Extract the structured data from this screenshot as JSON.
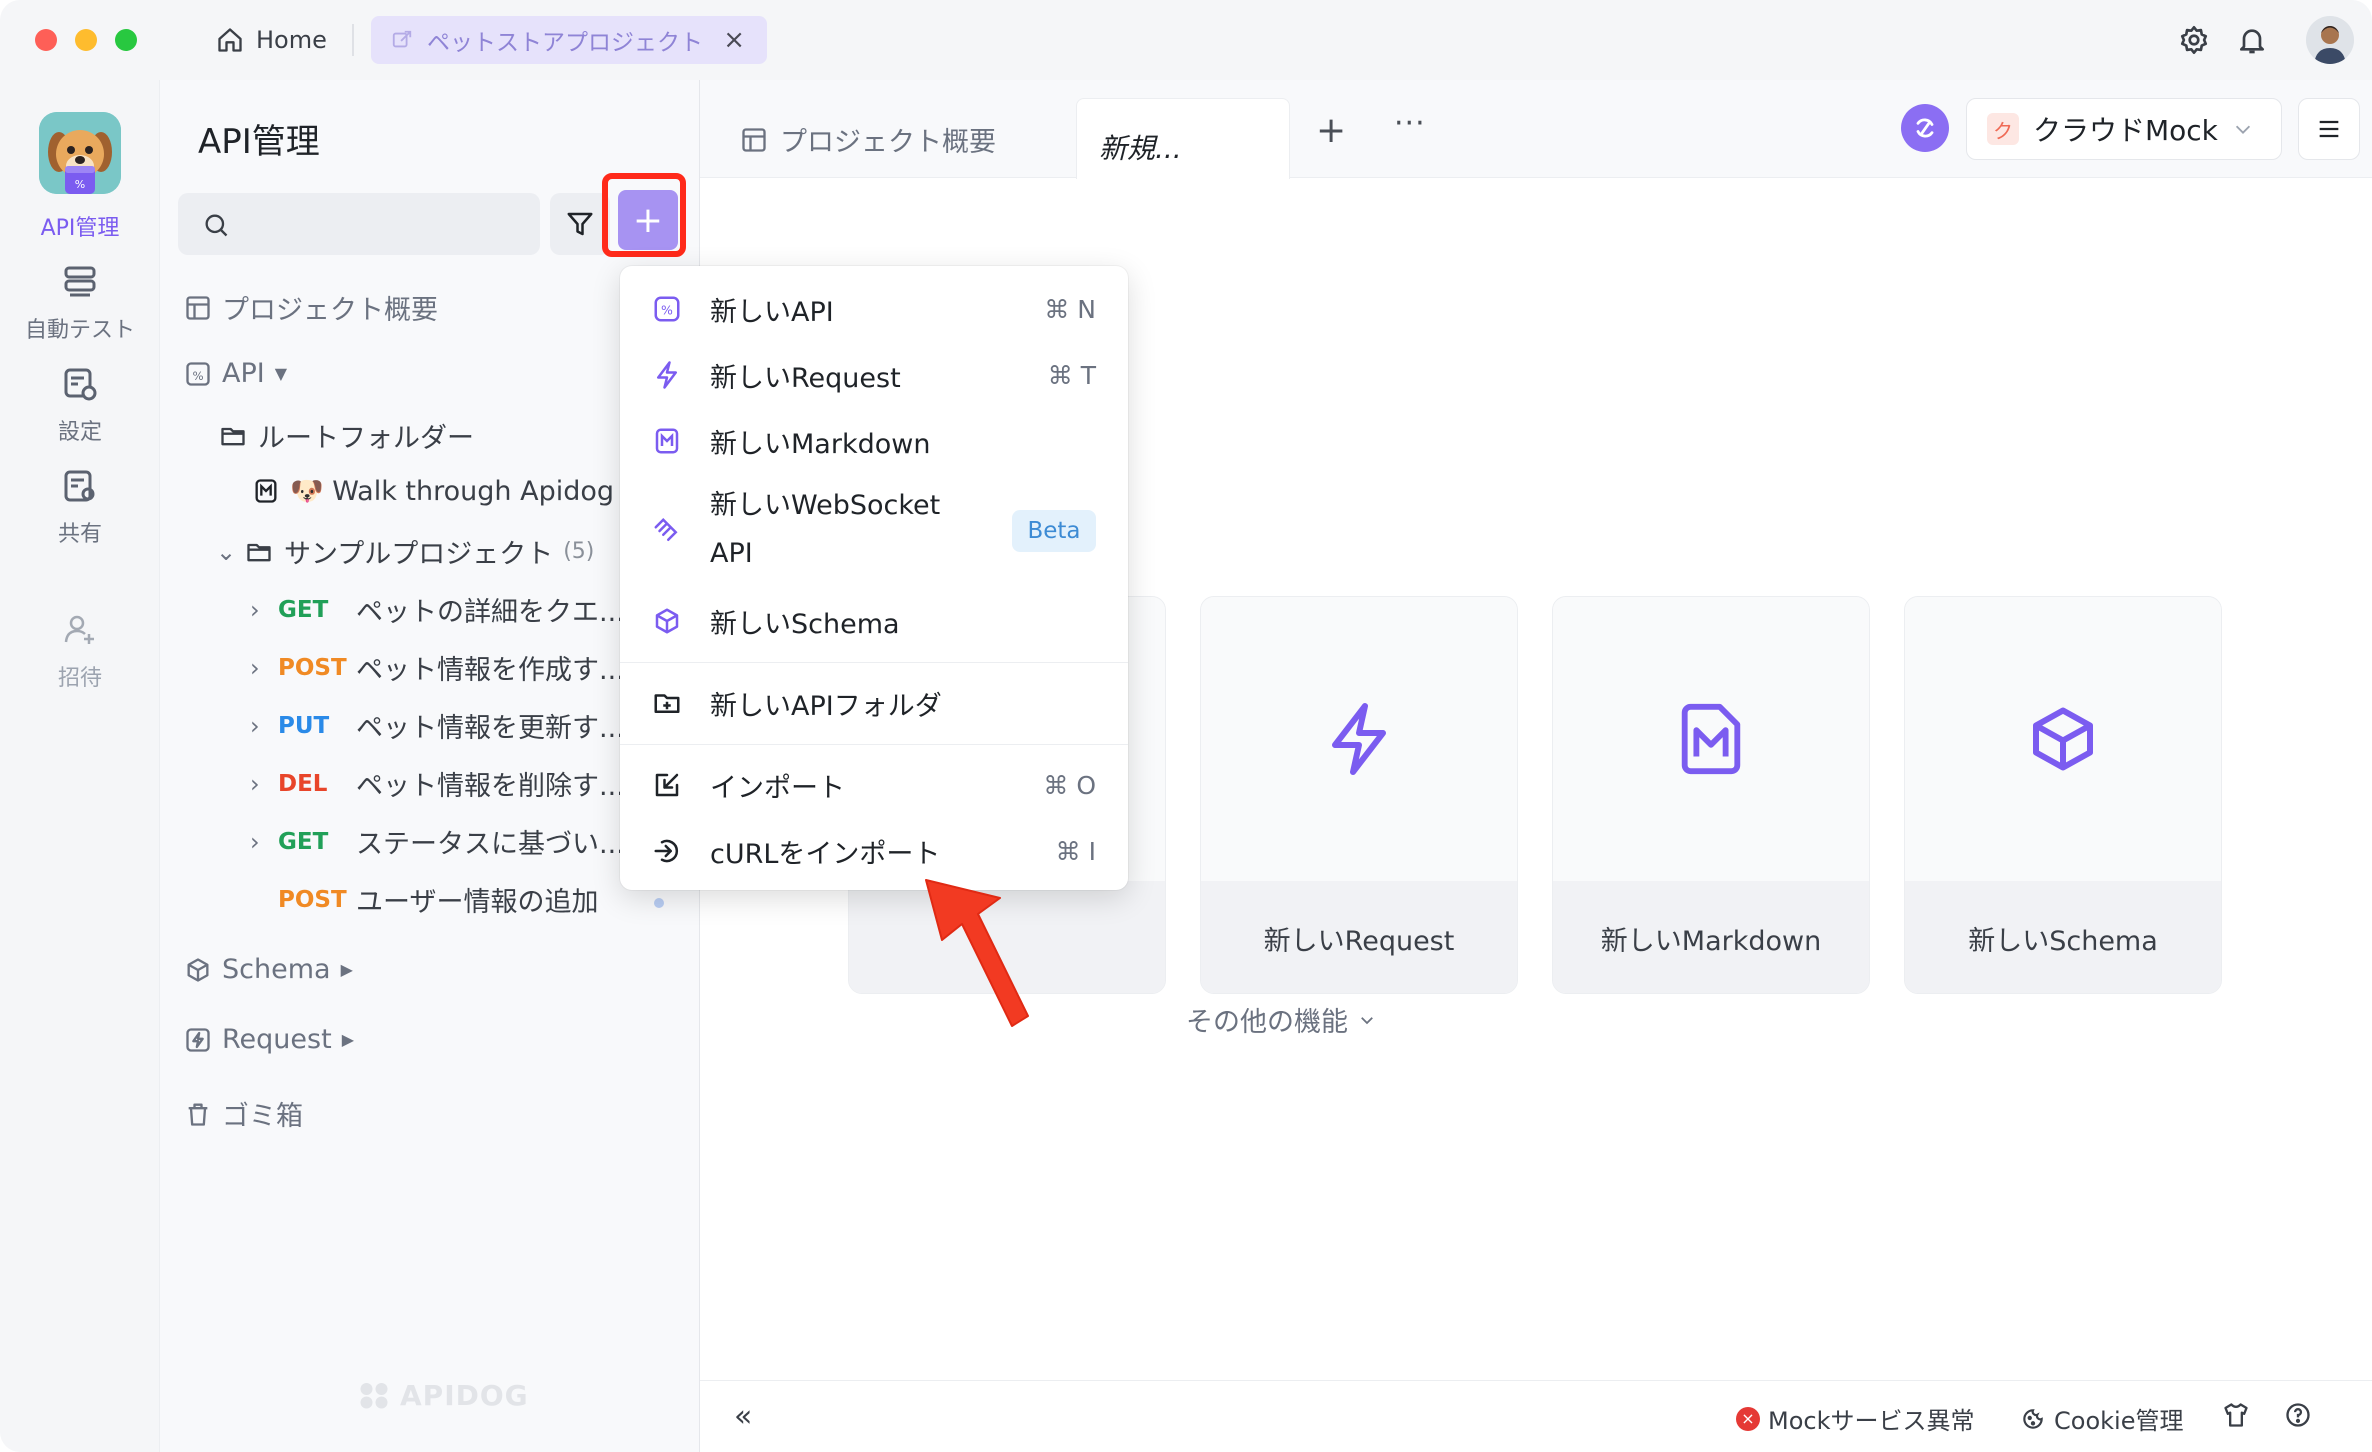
{
  "titlebar": {
    "home_label": "Home",
    "project_tab_label": "ペットストアプロジェクト"
  },
  "rail": {
    "items": [
      {
        "label": "API管理"
      },
      {
        "label": "自動テスト"
      },
      {
        "label": "設定"
      },
      {
        "label": "共有"
      },
      {
        "label": "招待"
      }
    ]
  },
  "sidebar": {
    "title": "API管理",
    "tree": {
      "overview": "プロジェクト概要",
      "api": "API",
      "root_folder": "ルートフォルダー",
      "walkthrough": "🐶 Walk through Apidog",
      "sample_project": "サンプルプロジェクト",
      "sample_count": "(5)",
      "endpoints": [
        {
          "method": "GET",
          "name": "ペットの詳細をクエ..."
        },
        {
          "method": "POST",
          "name": "ペット情報を作成す..."
        },
        {
          "method": "PUT",
          "name": "ペット情報を更新す..."
        },
        {
          "method": "DEL",
          "name": "ペット情報を削除す..."
        },
        {
          "method": "GET",
          "name": "ステータスに基づい..."
        }
      ],
      "user_add": {
        "method": "POST",
        "name": "ユーザー情報の追加"
      },
      "schema": "Schema",
      "request": "Request",
      "trash": "ゴミ箱"
    },
    "watermark": "APIDOG"
  },
  "main": {
    "tabs": {
      "overview": "プロジェクト概要",
      "new": "新規..."
    },
    "env_label": "クラウドMock",
    "env_badge": "ク",
    "cards": [
      {
        "label": "新しいRequest",
        "icon": "lightning-icon"
      },
      {
        "label": "新しいMarkdown",
        "icon": "markdown-icon"
      },
      {
        "label": "新しいSchema",
        "icon": "cube-icon"
      }
    ],
    "more_funcs": "その他の機能"
  },
  "statusbar": {
    "mock_error": "Mockサービス異常",
    "cookie": "Cookie管理"
  },
  "dropdown": {
    "items": [
      {
        "label": "新しいAPI",
        "shortcut": "⌘ N"
      },
      {
        "label": "新しいRequest",
        "shortcut": "⌘ T"
      },
      {
        "label": "新しいMarkdown",
        "shortcut": ""
      },
      {
        "label": "新しいWebSocket",
        "label2": "API",
        "badge": "Beta"
      },
      {
        "label": "新しいSchema",
        "shortcut": ""
      },
      {
        "label": "新しいAPIフォルダ",
        "shortcut": ""
      },
      {
        "label": "インポート",
        "shortcut": "⌘ O"
      },
      {
        "label": "cURLをインポート",
        "shortcut": "⌘ I"
      }
    ]
  },
  "colors": {
    "accent": "#7b5cf0",
    "highlight": "#ff2a1a",
    "get": "#21a058",
    "post": "#f08a24",
    "put": "#2a8ae8",
    "del": "#e8452a"
  }
}
